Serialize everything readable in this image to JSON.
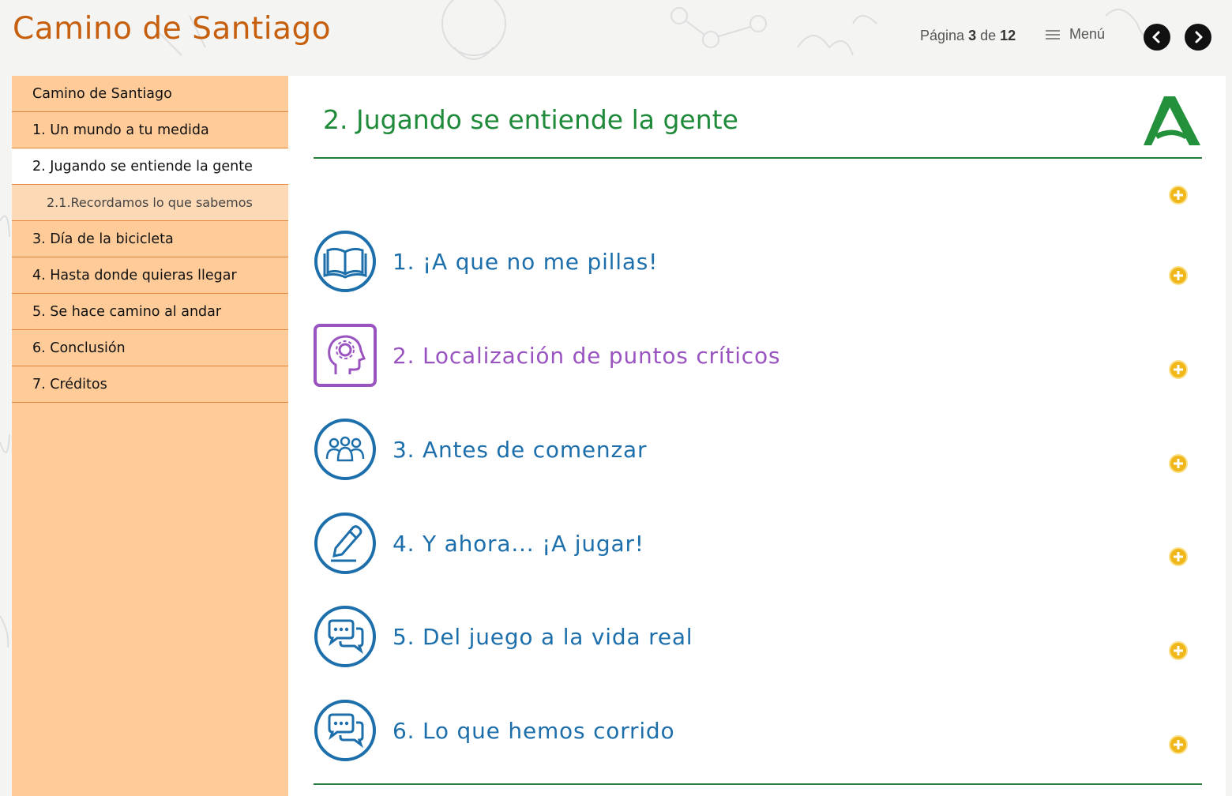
{
  "header": {
    "title": "Camino de Santiago",
    "pager_prefix": "Página",
    "page_current": "3",
    "pager_of": "de",
    "page_total": "12",
    "menu_label": "Menú"
  },
  "sidebar": {
    "items": [
      {
        "label": "Camino de Santiago"
      },
      {
        "label": "1. Un mundo a tu medida"
      },
      {
        "label": "2. Jugando se entiende la gente"
      },
      {
        "label": "2.1.Recordamos lo que sabemos"
      },
      {
        "label": "3. Día de la bicicleta"
      },
      {
        "label": "4. Hasta donde quieras llegar"
      },
      {
        "label": "5. Se hace camino al andar"
      },
      {
        "label": "6. Conclusión"
      },
      {
        "label": "7. Créditos"
      }
    ]
  },
  "main": {
    "heading": "2. Jugando se entiende la gente",
    "topics": [
      {
        "label": "1. ¡A que no me pillas!",
        "icon": "book-icon"
      },
      {
        "label": "2. Localización de puntos críticos",
        "icon": "head-gear-icon"
      },
      {
        "label": "3. Antes de comenzar",
        "icon": "group-icon"
      },
      {
        "label": "4. Y ahora... ¡A jugar!",
        "icon": "pencil-icon"
      },
      {
        "label": "5. Del juego a la vida real",
        "icon": "chat-bubbles-icon"
      },
      {
        "label": "6. Lo que hemos corrido",
        "icon": "chat-bubbles-icon"
      }
    ]
  },
  "colors": {
    "brand_orange": "#c6600f",
    "sidebar_bg": "#fecb99",
    "heading_green": "#1f8a3a",
    "topic_blue": "#1d6fac",
    "topic_purple": "#9a54c0",
    "plus_yellow": "#f0b71a"
  }
}
